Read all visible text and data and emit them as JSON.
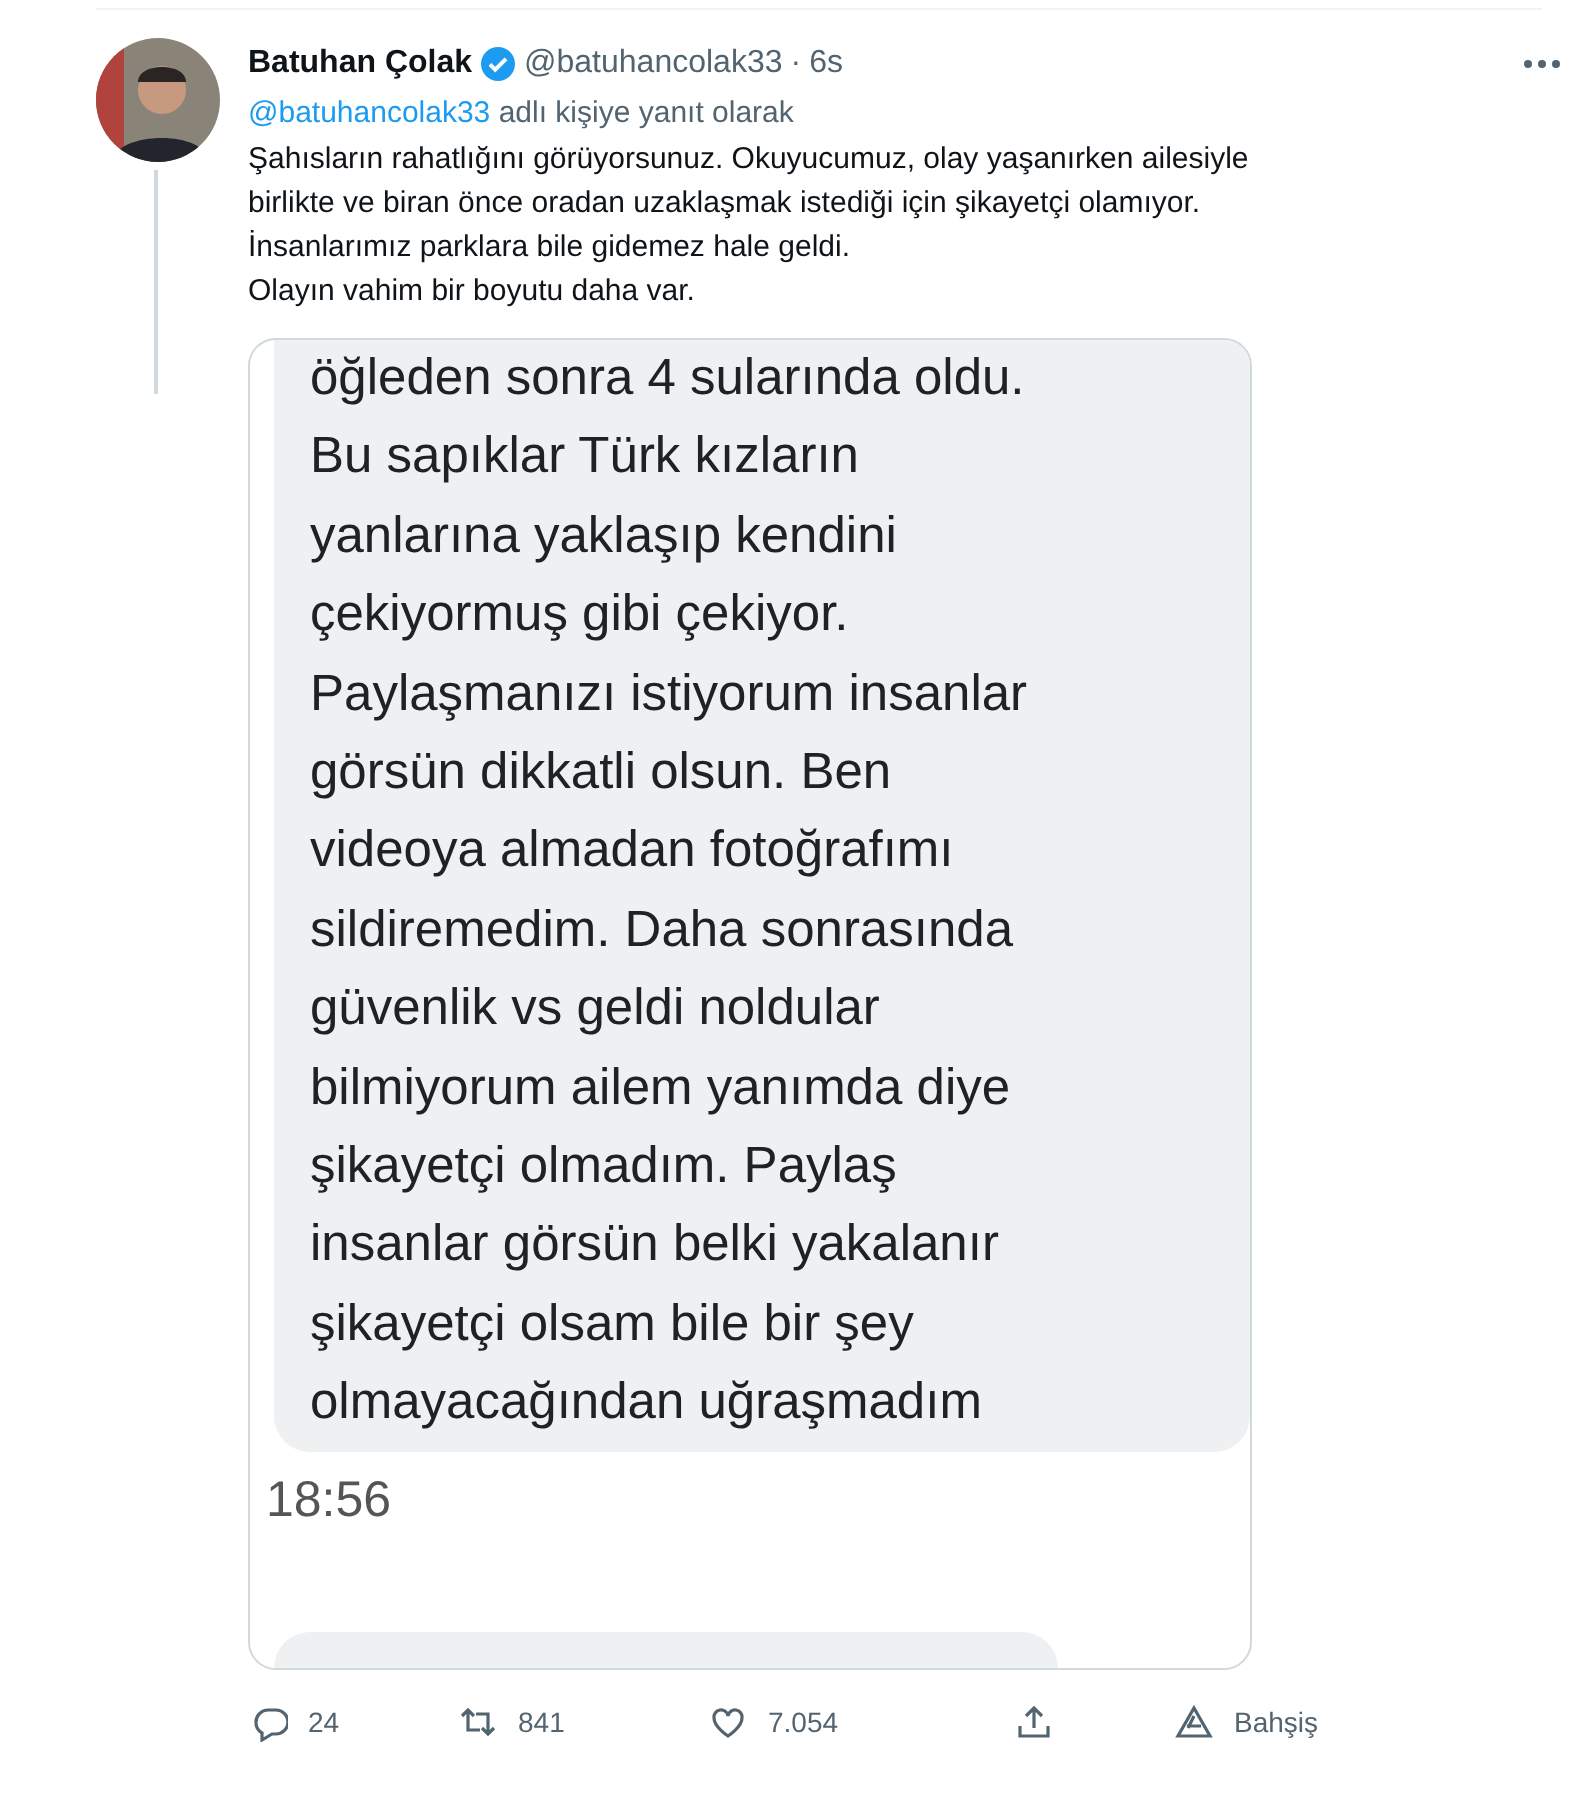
{
  "author": {
    "name": "Batuhan Çolak",
    "handle": "@batuhancolak33",
    "separator": "·",
    "time": "6s"
  },
  "reply_to": {
    "handle": "@batuhancolak33",
    "suffix": "adlı kişiye yanıt olarak"
  },
  "body": [
    "Şahısların rahatlığını görüyorsunuz. Okuyucumuz, olay yaşanırken ailesiyle",
    "birlikte ve biran önce oradan uzaklaşmak istediği için şikayetçi olamıyor.",
    "İnsanlarımız parklara bile gidemez hale geldi.",
    "Olayın vahim bir boyutu daha var."
  ],
  "attachment": {
    "message_lines": [
      "öğleden sonra 4 sularında oldu.",
      "Bu sapıklar Türk kızların",
      "yanlarına yaklaşıp kendini",
      "çekiyormuş gibi çekiyor.",
      "Paylaşmanızı istiyorum insanlar",
      "görsün dikkatli olsun. Ben",
      "videoya almadan fotoğrafımı",
      "sildiremedim. Daha sonrasında",
      "güvenlik vs geldi noldular",
      "bilmiyorum ailem yanımda diye",
      "şikayetçi olmadım. Paylaş",
      "insanlar görsün belki yakalanır",
      "şikayetçi olsam bile bir şey",
      "olmayacağından uğraşmadım"
    ],
    "time": "18:56"
  },
  "actions": [
    {
      "kind": "reply",
      "count": "24"
    },
    {
      "kind": "retweet",
      "count": "841"
    },
    {
      "kind": "like",
      "count": "7.054"
    },
    {
      "kind": "share"
    },
    {
      "kind": "tip",
      "label": "Bahşiş"
    }
  ]
}
